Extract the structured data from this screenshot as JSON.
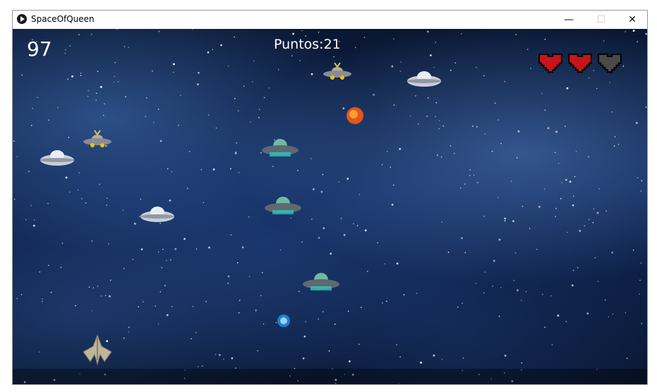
{
  "window": {
    "title": "SpaceOfQueen",
    "minimize": "—",
    "maximize": "☐",
    "close": "✕"
  },
  "hud": {
    "timer": "97",
    "score_text": "Puntos:21",
    "lives_total": 3,
    "lives_remaining": 2
  },
  "colors": {
    "heart_full": "#c8151b",
    "heart_empty": "#4a4a4a",
    "text": "#ffffff"
  },
  "icons": {
    "app": "play-circle-icon",
    "heart": "pixel-heart-icon"
  },
  "entities": [
    "silver-ufo",
    "alien-ufo",
    "green-ufo",
    "fireball",
    "player-ship",
    "blue-bullet"
  ]
}
